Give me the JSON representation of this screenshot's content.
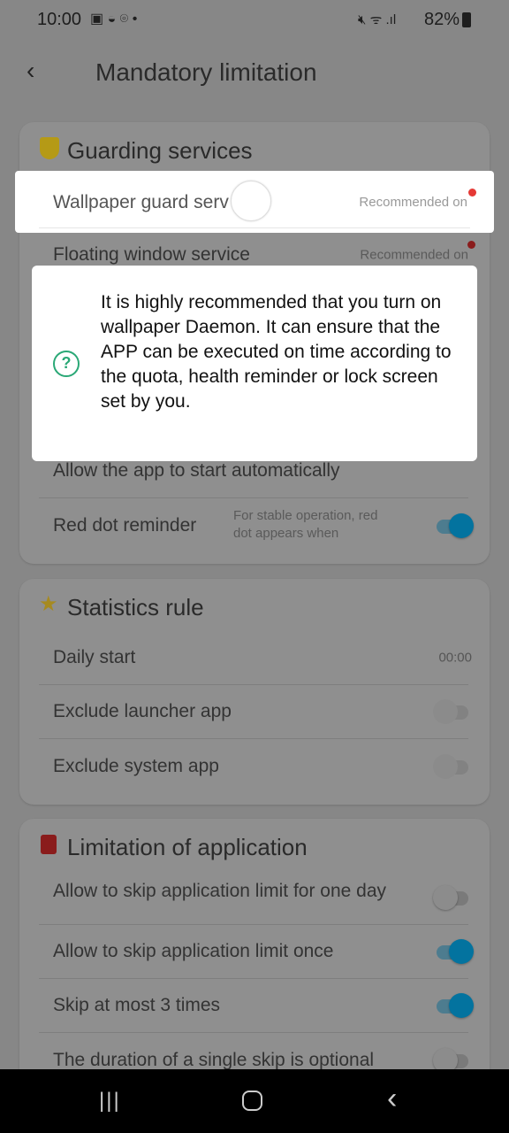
{
  "status": {
    "time": "10:00",
    "battery": "82%"
  },
  "header": {
    "title": "Mandatory limitation"
  },
  "guarding": {
    "title": "Guarding services",
    "rows": [
      {
        "label": "Wallpaper guard serv",
        "value": "Recommended on"
      },
      {
        "label": "Floating window service",
        "value": "Recommended on"
      },
      {
        "label": "Allow the app to start automatically"
      },
      {
        "label": "Red dot reminder",
        "note": "For stable operation, red dot appears when",
        "on": true
      }
    ]
  },
  "dialog": {
    "text": "It is highly recommended that you turn on wallpaper Daemon. It can ensure that the APP can be executed on time according to the quota, health reminder or lock screen set by you.",
    "icon": "question-circle-icon",
    "accent": "#2aa876"
  },
  "statistics": {
    "title": "Statistics rule",
    "rows": [
      {
        "label": "Daily start",
        "value": "00:00"
      },
      {
        "label": "Exclude launcher app",
        "on": false
      },
      {
        "label": "Exclude system app",
        "on": false
      }
    ]
  },
  "limitation": {
    "title": "Limitation of application",
    "rows": [
      {
        "label": "Allow to skip application limit for one day",
        "on": false
      },
      {
        "label": "Allow to skip application limit once",
        "on": true
      },
      {
        "label": "Skip at most 3 times",
        "on": true
      },
      {
        "label": "The duration of a single skip is optional",
        "on": false
      }
    ]
  }
}
